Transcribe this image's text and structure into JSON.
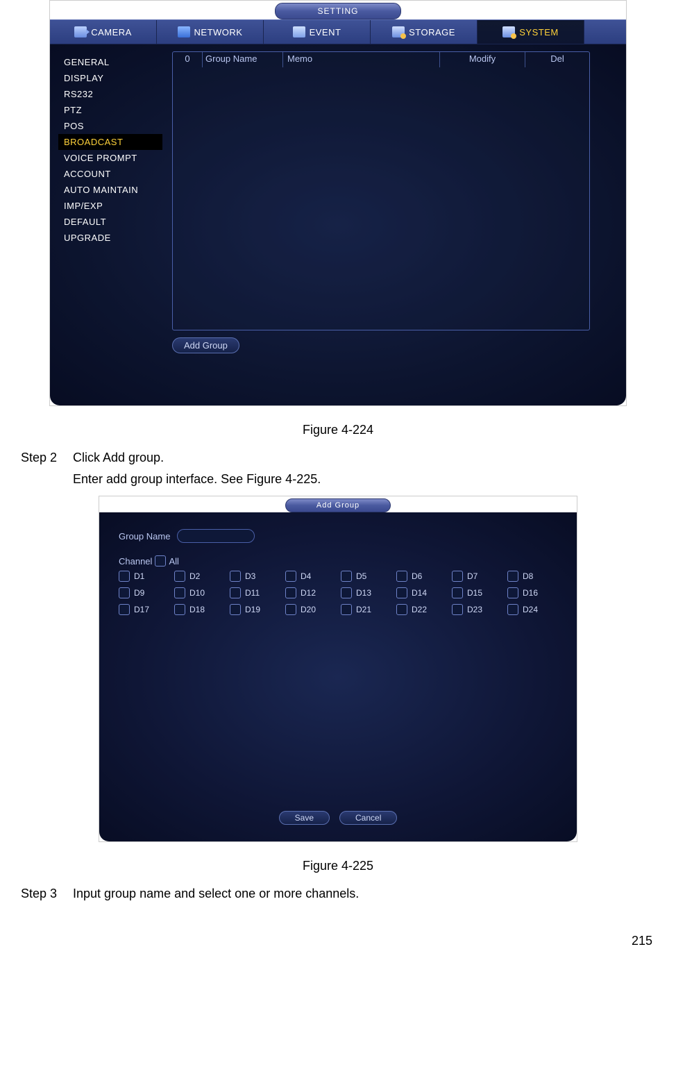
{
  "fig1": {
    "title": "SETTING",
    "tabs": [
      {
        "label": "CAMERA"
      },
      {
        "label": "NETWORK"
      },
      {
        "label": "EVENT"
      },
      {
        "label": "STORAGE"
      },
      {
        "label": "SYSTEM"
      }
    ],
    "sidebar": [
      "GENERAL",
      "DISPLAY",
      "RS232",
      "PTZ",
      "POS",
      "BROADCAST",
      "VOICE PROMPT",
      "ACCOUNT",
      "AUTO MAINTAIN",
      "IMP/EXP",
      "DEFAULT",
      "UPGRADE"
    ],
    "table": {
      "count": "0",
      "cols": {
        "groupname": "Group Name",
        "memo": "Memo",
        "modify": "Modify",
        "del": "Del"
      }
    },
    "add_group_btn": "Add Group",
    "caption": "Figure 4-224"
  },
  "step2": {
    "label": "Step 2",
    "line1": "Click Add group.",
    "line2": "Enter add group interface. See Figure 4-225."
  },
  "fig2": {
    "title": "Add Group",
    "groupname_label": "Group Name",
    "channel_label": "Channel",
    "all_label": "All",
    "channels": [
      "D1",
      "D2",
      "D3",
      "D4",
      "D5",
      "D6",
      "D7",
      "D8",
      "D9",
      "D10",
      "D11",
      "D12",
      "D13",
      "D14",
      "D15",
      "D16",
      "D17",
      "D18",
      "D19",
      "D20",
      "D21",
      "D22",
      "D23",
      "D24"
    ],
    "save_btn": "Save",
    "cancel_btn": "Cancel",
    "caption": "Figure 4-225"
  },
  "step3": {
    "label": "Step 3",
    "line1": "Input group name and select one or more channels."
  },
  "page_number": "215"
}
